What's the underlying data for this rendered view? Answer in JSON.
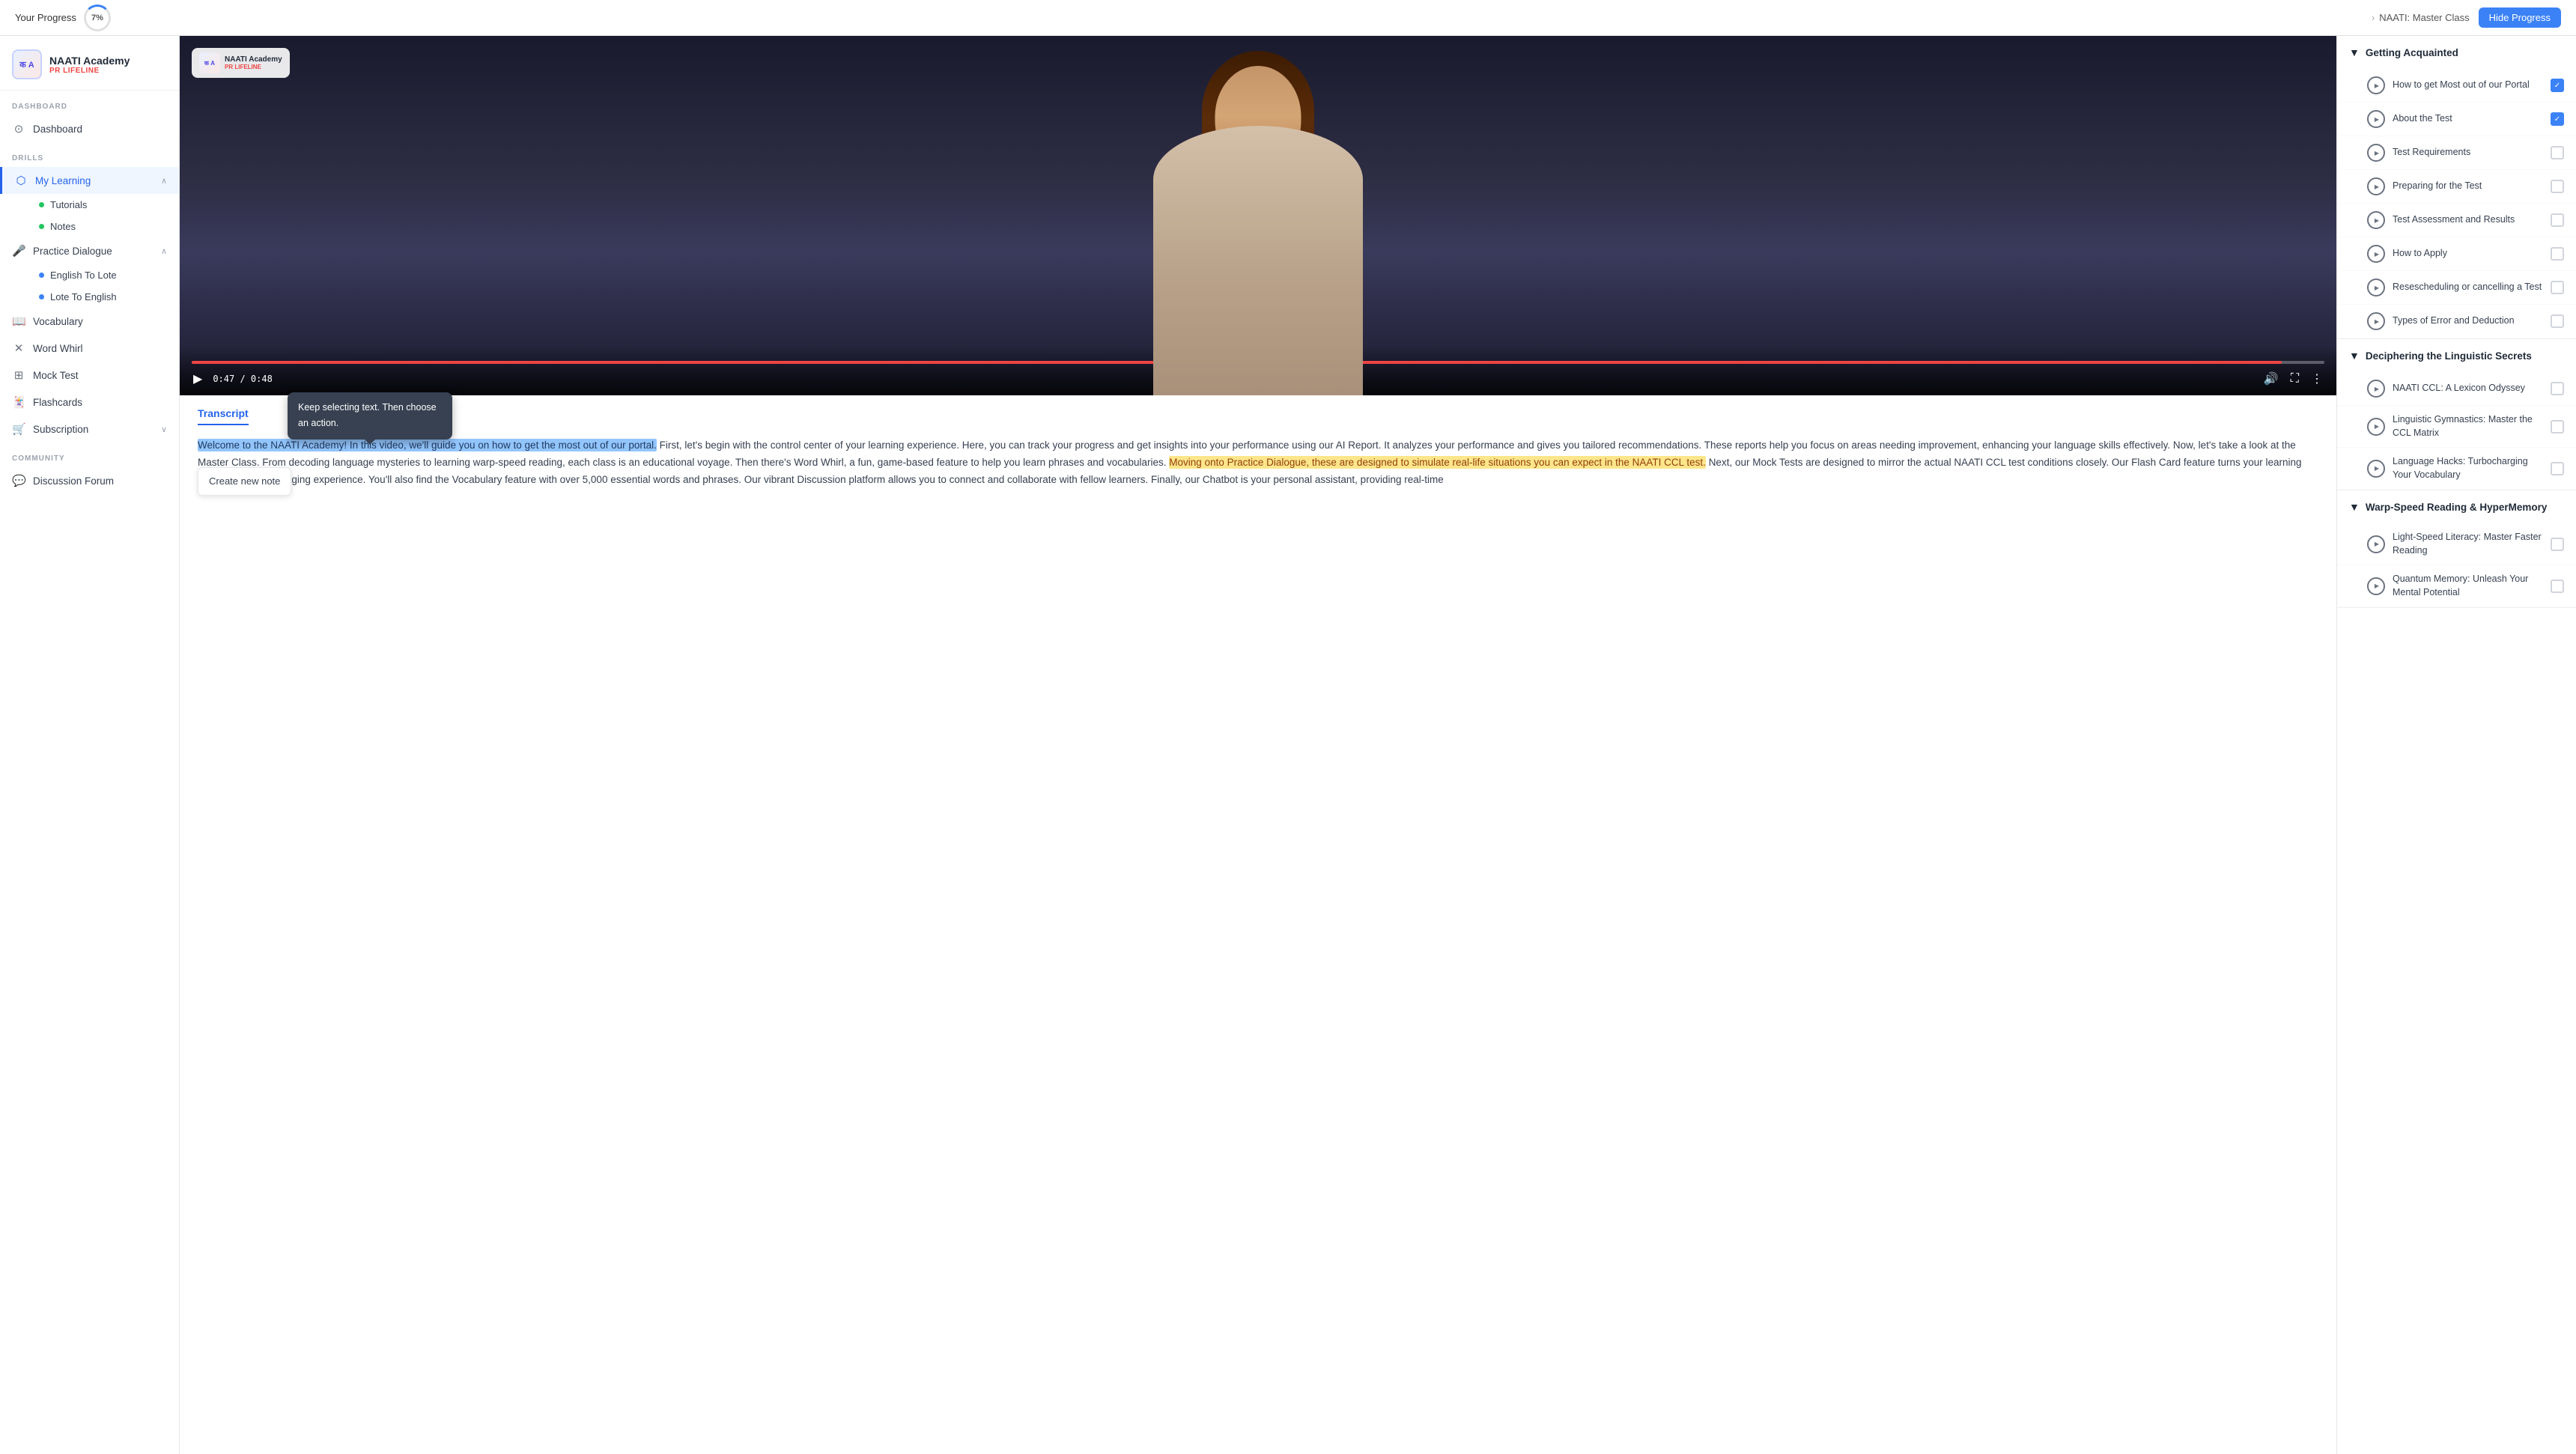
{
  "topBar": {
    "progressLabel": "Your Progress",
    "progressPercent": "7%",
    "breadcrumb": {
      "item": "NAATI: Master Class"
    },
    "hideProgressBtn": "Hide Progress"
  },
  "sidebar": {
    "logo": {
      "name": "NAATI Academy",
      "subtitle": "PR LIFELINE",
      "icon": "क ख A"
    },
    "sections": [
      {
        "label": "DASHBOARD",
        "items": [
          {
            "id": "dashboard",
            "label": "Dashboard",
            "icon": "⊙",
            "active": false
          }
        ]
      },
      {
        "label": "DRILLS",
        "items": [
          {
            "id": "my-learning",
            "label": "My Learning",
            "icon": "⬡",
            "active": true,
            "expanded": true,
            "sub": [
              {
                "id": "tutorials",
                "label": "Tutorials",
                "dot": "green"
              },
              {
                "id": "notes",
                "label": "Notes",
                "dot": "green"
              }
            ]
          },
          {
            "id": "practice-dialogue",
            "label": "Practice Dialogue",
            "icon": "🎤",
            "active": false,
            "expandable": true,
            "sub": [
              {
                "id": "english-to-lote",
                "label": "English To Lote",
                "dot": "green"
              },
              {
                "id": "lote-to-english",
                "label": "Lote To English",
                "dot": "green"
              }
            ]
          },
          {
            "id": "vocabulary",
            "label": "Vocabulary",
            "icon": "📖",
            "active": false
          },
          {
            "id": "word-whirl",
            "label": "Word Whirl",
            "icon": "✕",
            "active": false
          },
          {
            "id": "mock-test",
            "label": "Mock Test",
            "icon": "⊞",
            "active": false
          },
          {
            "id": "flashcards",
            "label": "Flashcards",
            "icon": "🃏",
            "active": false
          },
          {
            "id": "subscription",
            "label": "Subscription",
            "icon": "🛒",
            "active": false,
            "expandable": true
          }
        ]
      },
      {
        "label": "COMMUNITY",
        "items": [
          {
            "id": "discussion-forum",
            "label": "Discussion Forum",
            "icon": "💬",
            "active": false
          }
        ]
      }
    ]
  },
  "video": {
    "currentTime": "0:47",
    "totalTime": "0:48",
    "progressPercent": 98
  },
  "transcript": {
    "tabLabel": "Transcript",
    "tooltip": {
      "text": "Keep selecting text. Then choose an action."
    },
    "contextMenuItem": "Create new note",
    "text": {
      "highlighted": "Welcome to the NAATI Academy! In this video, we'll guide you on how to get the most out of our portal.",
      "part1": " First, let's begin with the control center of your learning experience. Here, you can track your progress and get insights into your ",
      "part2": "performance using our AI Report. It analyzes your performance and gives you tailored recommendations. These reports help you focus on areas needing improvement, enhancing your language skills effectively. Now, let's take a look at the Master Class. From decoding language mysteries to learning warp-speed reading, each class is an educational voyage. Then there's Word Whirl, a fun, game-based feature to help you learn phrases and vocabularies. ",
      "highlighted2": "Moving onto Practice Dialogue, these are designed to simulate real-life situations you can expect in the NAATI CCL test.",
      "part3": " Next, our Mock Tests are designed to mirror the actual NAATI CCL test conditions closely. Our Flash Card feature turns your learning process into an engaging experience. You'll also find the Vocabulary feature with over 5,000 essential words and phrases. Our vibrant Discussion platform allows you to connect and collaborate with fellow learners. Finally, our Chatbot is your personal assistant, providing real-time"
    }
  },
  "rightPanel": {
    "breadcrumb": "NAATI: Master Class",
    "sections": [
      {
        "id": "getting-acquainted",
        "label": "Getting Acquainted",
        "expanded": true,
        "lessons": [
          {
            "id": "how-to-get-most",
            "label": "How to get Most out of our Portal",
            "checked": true
          },
          {
            "id": "about-the-test",
            "label": "About the Test",
            "checked": true
          },
          {
            "id": "test-requirements",
            "label": "Test Requirements",
            "checked": false
          },
          {
            "id": "preparing-for-test",
            "label": "Preparing for the Test",
            "checked": false
          },
          {
            "id": "test-assessment",
            "label": "Test Assessment and Results",
            "checked": false
          },
          {
            "id": "how-to-apply",
            "label": "How to Apply",
            "checked": false
          },
          {
            "id": "rescheduling",
            "label": "Resescheduling or cancelling a Test",
            "checked": false
          },
          {
            "id": "types-of-error",
            "label": "Types of Error and Deduction",
            "checked": false
          }
        ]
      },
      {
        "id": "deciphering-linguistic",
        "label": "Deciphering the Linguistic Secrets",
        "expanded": false,
        "lessons": [
          {
            "id": "naati-ccl-lexicon",
            "label": "NAATI CCL: A Lexicon Odyssey",
            "checked": false
          },
          {
            "id": "linguistic-gymnastics",
            "label": "Linguistic Gymnastics: Master the CCL Matrix",
            "checked": false
          },
          {
            "id": "language-hacks",
            "label": "Language Hacks: Turbocharging Your Vocabulary",
            "checked": false
          }
        ]
      },
      {
        "id": "warp-speed-reading",
        "label": "Warp-Speed Reading & HyperMemory",
        "expanded": false,
        "lessons": [
          {
            "id": "light-speed-literacy",
            "label": "Light-Speed Literacy: Master Faster Reading",
            "checked": false
          },
          {
            "id": "quantum-memory",
            "label": "Quantum Memory: Unleash Your Mental Potential",
            "checked": false
          }
        ]
      }
    ]
  }
}
